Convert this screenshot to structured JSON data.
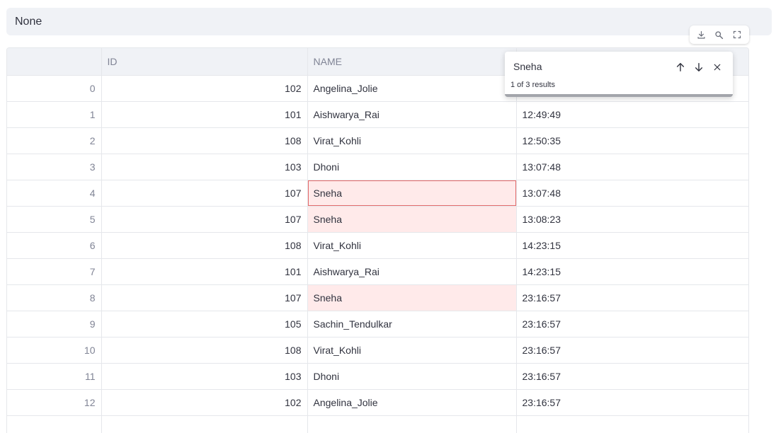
{
  "info_text": "None",
  "toolbar": {
    "icons": [
      "download-icon",
      "search-icon",
      "fullscreen-icon"
    ]
  },
  "search": {
    "value": "Sneha",
    "results_text": "1 of 3 results",
    "icons": [
      "arrow-up-icon",
      "arrow-down-icon",
      "close-icon"
    ]
  },
  "table": {
    "columns": [
      "",
      "ID",
      "NAME",
      ""
    ],
    "rows": [
      {
        "index": "0",
        "id": "102",
        "name": "Angelina_Jolie",
        "time": ""
      },
      {
        "index": "1",
        "id": "101",
        "name": "Aishwarya_Rai",
        "time": "12:49:49"
      },
      {
        "index": "2",
        "id": "108",
        "name": "Virat_Kohli",
        "time": "12:50:35"
      },
      {
        "index": "3",
        "id": "103",
        "name": "Dhoni",
        "time": "13:07:48"
      },
      {
        "index": "4",
        "id": "107",
        "name": "Sneha",
        "time": "13:07:48"
      },
      {
        "index": "5",
        "id": "107",
        "name": "Sneha",
        "time": "13:08:23"
      },
      {
        "index": "6",
        "id": "108",
        "name": "Virat_Kohli",
        "time": "14:23:15"
      },
      {
        "index": "7",
        "id": "101",
        "name": "Aishwarya_Rai",
        "time": "14:23:15"
      },
      {
        "index": "8",
        "id": "107",
        "name": "Sneha",
        "time": "23:16:57"
      },
      {
        "index": "9",
        "id": "105",
        "name": "Sachin_Tendulkar",
        "time": "23:16:57"
      },
      {
        "index": "10",
        "id": "108",
        "name": "Virat_Kohli",
        "time": "23:16:57"
      },
      {
        "index": "11",
        "id": "103",
        "name": "Dhoni",
        "time": "23:16:57"
      },
      {
        "index": "12",
        "id": "102",
        "name": "Angelina_Jolie",
        "time": "23:16:57"
      },
      {
        "index": "",
        "id": "",
        "name": "",
        "time": ""
      }
    ],
    "highlight_color": "#ffeaea",
    "active_match_border": "#e46a6a"
  }
}
